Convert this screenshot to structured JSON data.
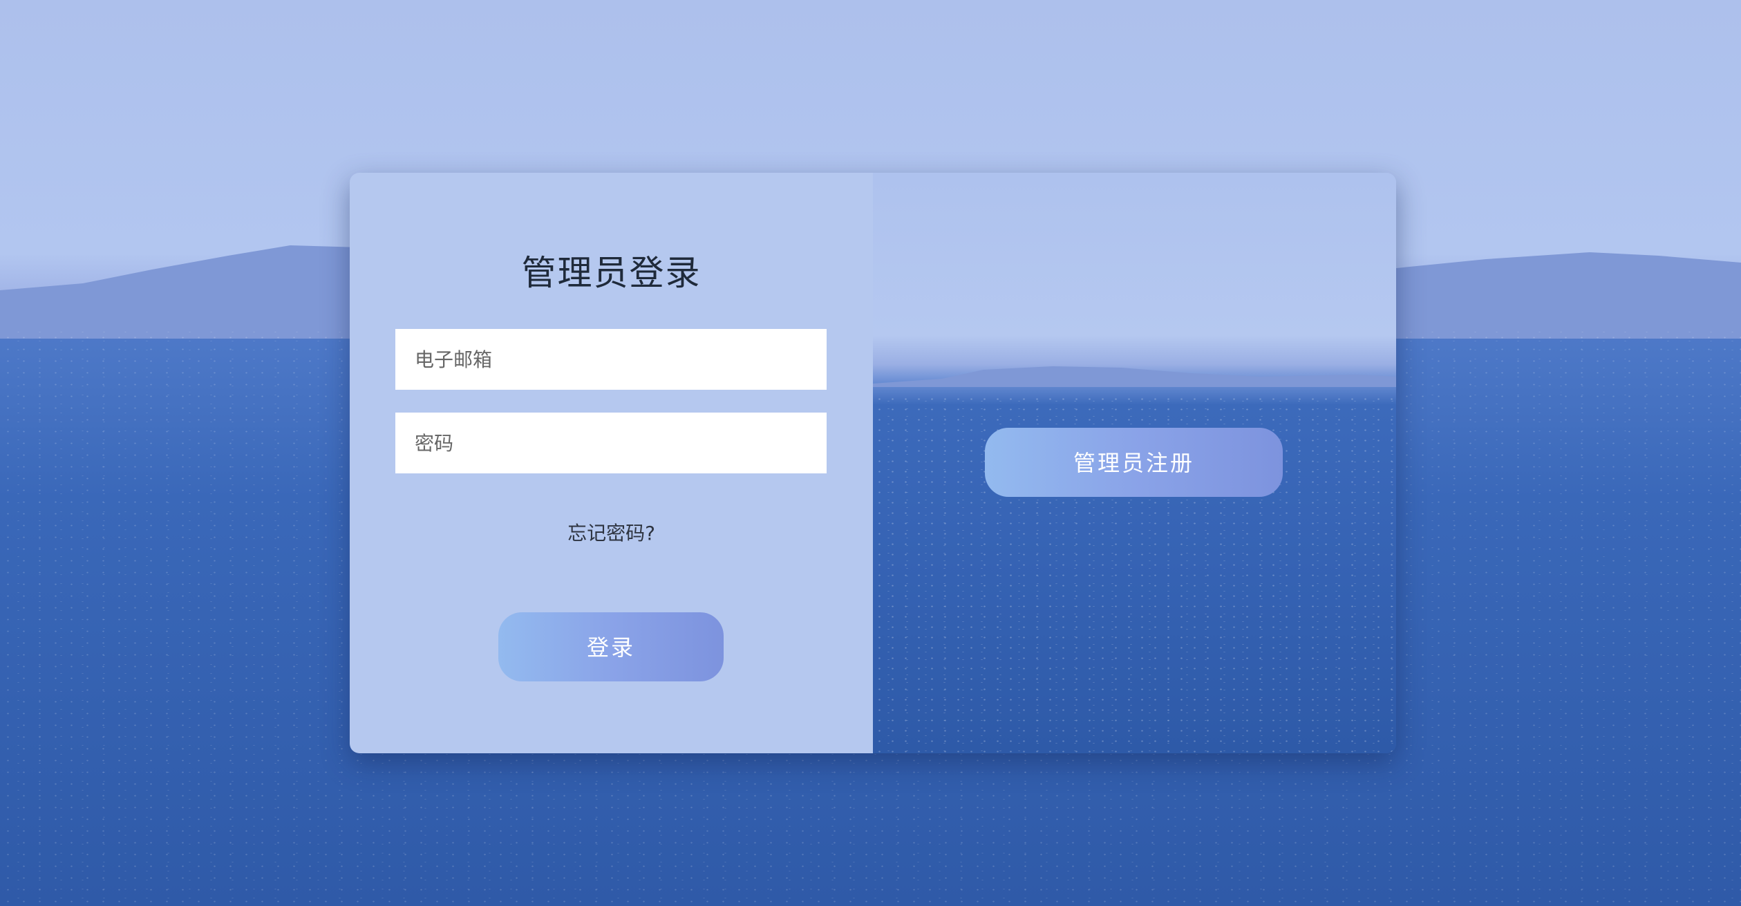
{
  "login": {
    "title": "管理员登录",
    "email_placeholder": "电子邮箱",
    "password_placeholder": "密码",
    "forgot_password": "忘记密码?",
    "submit_label": "登录"
  },
  "register": {
    "button_label": "管理员注册"
  },
  "colors": {
    "panel": "#b5c8ef",
    "button_start": "#93baef",
    "button_end": "#7d93de",
    "ocean": "#2f5aa8"
  }
}
